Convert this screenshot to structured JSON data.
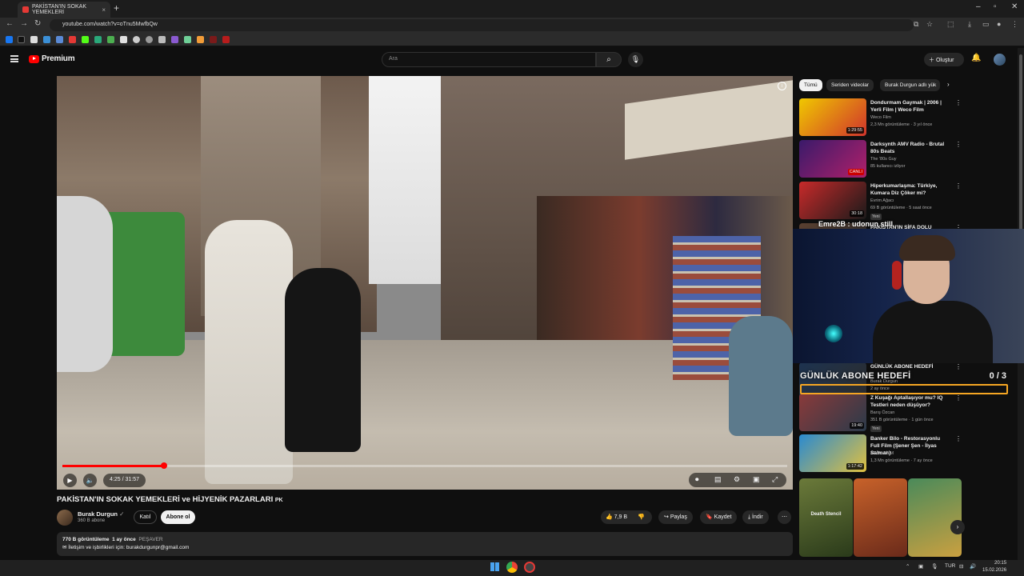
{
  "browser": {
    "tab_title": "PAKİSTAN'IN SOKAK YEMEKLERİ",
    "url": "youtube.com/watch?v=oTnu5MwfbQw",
    "new_tab_symbol": "+",
    "tab_close_symbol": "×"
  },
  "youtube": {
    "logo_text": "Premium",
    "search_placeholder": "Ara",
    "create_label": "Oluştur"
  },
  "player": {
    "time_current": "4:25",
    "time_total": "31:57",
    "time_display": "4:25 / 31:57",
    "progress_fraction": 0.14
  },
  "video": {
    "title": "PAKİSTAN'IN SOKAK YEMEKLERİ ve HİJYENİK PAZARLARI",
    "title_flag": "PK",
    "channel_name": "Burak Durgun",
    "subscribers": "360 B abone",
    "join_label": "Katıl",
    "subscribe_label": "Abone ol",
    "like_count": "7,9 B",
    "share_label": "Paylaş",
    "save_label": "Kaydet",
    "download_label": "İndir",
    "views": "770 B görüntüleme",
    "date": "1 ay önce",
    "location": "PEŞAVER",
    "description_line": "İletişim ve işbirlikleri için: burakdurgunpr@gmail.com"
  },
  "sidebar": {
    "chips": [
      "Tümü",
      "Seriden videolar",
      "Burak Durgun adlı yük"
    ],
    "recommendations": [
      {
        "title": "Dondurmam Gaymak | 2006 | Yerli Film | Weco Film",
        "channel": "Weco Film",
        "meta": "2,3 Mn görüntüleme · 3 yıl önce",
        "duration": "1:29:55",
        "colors": [
          "#f0c800",
          "#d0342c"
        ]
      },
      {
        "title": "Darksynth AMV Radio - Brutal 80s Beats",
        "channel": "The '80s Guy",
        "meta": "85 kullanıcı izliyor",
        "duration": "CANLI",
        "colors": [
          "#3a1a6a",
          "#b0206a"
        ]
      },
      {
        "title": "Hiperkumarlaşma: Türkiye, Kumara Diz Çöker mi?",
        "channel": "Evrim Ağacı",
        "meta": "69 B görüntüleme · 5 saat önce",
        "duration": "30:18",
        "badge": "Yeni",
        "colors": [
          "#c82a2a",
          "#1a1a1a"
        ]
      },
      {
        "title": "PAKİSTAN'IN ŞİFA DOLU SOKAK",
        "channel": "Burak Durgun",
        "meta": "",
        "duration": "",
        "colors": [
          "#5a4030",
          "#2a2a2a"
        ]
      },
      {
        "title": "GÜNLÜK ABONE HEDEFİ",
        "channel": "Burak Durgun",
        "meta": "2 ay önce",
        "duration": "",
        "colors": [
          "#1d3350",
          "#2c2c2c"
        ]
      },
      {
        "title": "Z Kuşağı Aptallaşıyor mu? IQ Testleri neden düşüyor?",
        "channel": "Barış Özcan",
        "meta": "351 B görüntüleme · 1 gün önce",
        "duration": "19:40",
        "badge": "Yeni",
        "colors": [
          "#8a3a3a",
          "#2a3a4a"
        ]
      },
      {
        "title": "Banker Bilo - Restorasyonlu Full Film (Şener Şen - İlyas Salman)",
        "channel": "ARZU FİLM",
        "meta": "1,3 Mn görüntüleme · 7 ay önce",
        "duration": "1:17:42",
        "colors": [
          "#2a8ad0",
          "#e0c040"
        ]
      }
    ],
    "live_label": "CANLI",
    "shorts": [
      {
        "caption": "Death Stencil",
        "colors": [
          "#6b7a3a",
          "#2a3a1a"
        ]
      },
      {
        "caption": "",
        "colors": [
          "#c8622a",
          "#6a2a1a"
        ]
      },
      {
        "caption": "",
        "colors": [
          "#4a8a5a",
          "#caa040"
        ]
      }
    ]
  },
  "stream_overlay": {
    "username": "Emre2B",
    "text": "udonun still",
    "name_display": "Emre2B : udonun still",
    "goal_label": "GÜNLÜK ABONE HEDEFİ",
    "goal_value": "0 / 3",
    "goal_fraction": 0
  },
  "taskbar": {
    "language": "TUR",
    "time": "20:15",
    "date": "15.02.2026"
  },
  "colors": {
    "yt_red": "#ff0000",
    "background": "#0f0f0f",
    "goal_border": "#f5a623"
  }
}
